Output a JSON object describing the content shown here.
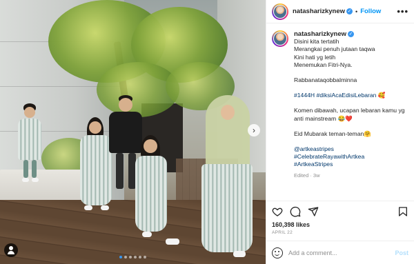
{
  "post": {
    "username": "natasharizkynew",
    "header_separator": "•",
    "follow_label": "Follow",
    "more_label": "•••",
    "caption_lines": [
      "Disini kita tertatih",
      "Merangkai penuh jutaan taqwa",
      "Kini hati yg letih",
      "Menemukan Fitri-Nya.",
      "",
      "Rabbanataqobbalminna",
      "",
      "#1444H #diksiAcaEdisiLebaran 🥰",
      "",
      "Komen dibawah, ucapan lebaran kamu yg anti mainstream 😂❤️",
      "",
      "Eid Mubarak teman-teman🤗",
      "",
      "@artkeastripes",
      "#CelebrateRayawithArtkea",
      "#ArtkeaStripes"
    ],
    "edited_label": "Edited · 3w",
    "likes_text": "160,398 likes",
    "date_text": "APRIL 22",
    "comment_placeholder": "Add a comment...",
    "post_button_label": "Post",
    "carousel_next_label": "›",
    "carousel_dot_count": 6,
    "carousel_active_dot": 0
  },
  "colors": {
    "accent": "#0095f6",
    "verified": "#3897f0",
    "link": "#00376b",
    "muted": "#8e8e8e"
  },
  "icons": {
    "like": "heart-icon",
    "comment": "comment-icon",
    "share": "paper-plane-icon",
    "save": "bookmark-icon",
    "emoji": "smiley-icon",
    "verified": "verified-badge-icon",
    "tags": "user-tag-icon"
  }
}
